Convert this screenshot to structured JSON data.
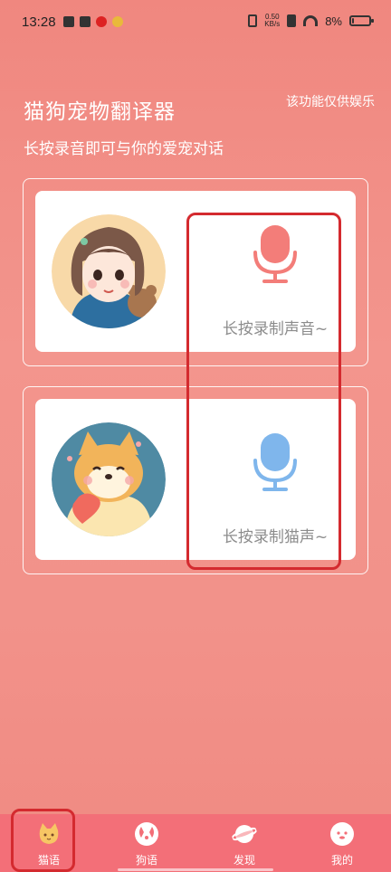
{
  "status_bar": {
    "time": "13:28",
    "net_speed_value": "0.50",
    "net_speed_unit": "KB/s",
    "battery_text": "8%",
    "battery_level": 0.08
  },
  "header": {
    "title": "猫狗宠物翻译器",
    "disclaimer": "该功能仅供娱乐",
    "subtitle": "长按录音即可与你的爱宠对话"
  },
  "cards": [
    {
      "avatar": "girl-avatar",
      "mic_icon": "mic-icon",
      "mic_color": "#f37d79",
      "label": "长按录制声音~"
    },
    {
      "avatar": "shiba-dog-avatar",
      "mic_icon": "mic-icon",
      "mic_color": "#7fb6ec",
      "label": "长按录制猫声~"
    }
  ],
  "tabbar": {
    "items": [
      {
        "label": "猫语",
        "icon": "cat-icon",
        "color": "#f7c664"
      },
      {
        "label": "狗语",
        "icon": "dog-icon",
        "color": "#ffffff"
      },
      {
        "label": "发现",
        "icon": "planet-icon",
        "color": "#ffffff"
      },
      {
        "label": "我的",
        "icon": "face-icon",
        "color": "#ffffff"
      }
    ]
  },
  "colors": {
    "background": "#f2928a",
    "highlight": "#d42a2f",
    "tabbar": "#f36f78"
  }
}
